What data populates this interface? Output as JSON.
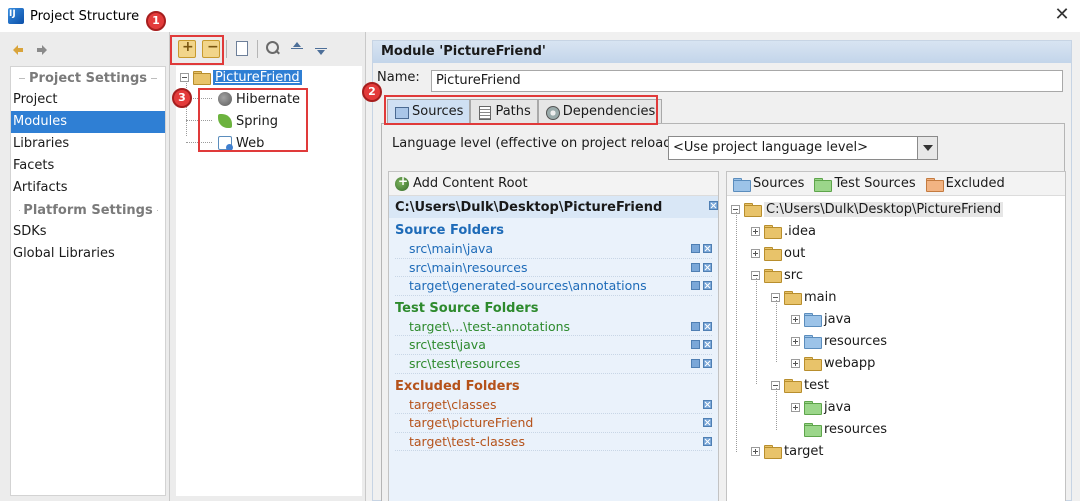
{
  "window": {
    "title": "Project Structure"
  },
  "left_nav": {
    "project_settings_header": "Project Settings",
    "project_settings_items": [
      "Project",
      "Modules",
      "Libraries",
      "Facets",
      "Artifacts"
    ],
    "platform_settings_header": "Platform Settings",
    "platform_settings_items": [
      "SDKs",
      "Global Libraries"
    ],
    "selected": "Modules"
  },
  "module_tree": {
    "module": "PictureFriend",
    "frameworks": [
      "Hibernate",
      "Spring",
      "Web"
    ]
  },
  "module_panel": {
    "header": "Module 'PictureFriend'",
    "name_label": "Name:",
    "name_value": "PictureFriend",
    "tabs": [
      "Sources",
      "Paths",
      "Dependencies"
    ],
    "active_tab": "Sources",
    "language_level_label": "Language level (effective on project reload):",
    "language_level_value": "<Use project language level>"
  },
  "content_roots": {
    "add_label": "Add Content Root",
    "root_path": "C:\\Users\\Dulk\\Desktop\\PictureFriend",
    "source_folders_title": "Source Folders",
    "source_folders": [
      "src\\main\\java",
      "src\\main\\resources",
      "target\\generated-sources\\annotations"
    ],
    "test_source_folders_title": "Test Source Folders",
    "test_source_folders": [
      "target\\...\\test-annotations",
      "src\\test\\java",
      "src\\test\\resources"
    ],
    "excluded_folders_title": "Excluded Folders",
    "excluded_folders": [
      "target\\classes",
      "target\\pictureFriend",
      "target\\test-classes"
    ]
  },
  "folder_tree": {
    "legend": [
      "Sources",
      "Test Sources",
      "Excluded"
    ],
    "root": "C:\\Users\\Dulk\\Desktop\\PictureFriend",
    "nodes": [
      ".idea",
      "out",
      "src",
      "main",
      "java",
      "resources",
      "webapp",
      "test",
      "java",
      "resources",
      "target"
    ]
  },
  "callouts": [
    "1",
    "2",
    "3"
  ],
  "colors": {
    "selection": "#2f7fd4",
    "callout": "#e03a3a",
    "source": "#1e6bb8",
    "test": "#2d8a2d",
    "excluded": "#b5521a"
  }
}
